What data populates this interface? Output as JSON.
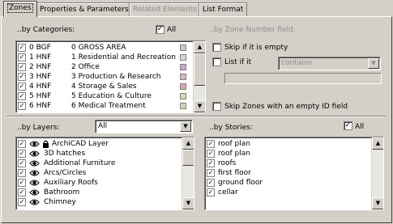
{
  "tabs": [
    {
      "label": "Zones"
    },
    {
      "label": "Properties & Parameters"
    },
    {
      "label": "Related Elements"
    },
    {
      "label": "List Format"
    }
  ],
  "categories": {
    "label": "..by Categories:",
    "all_label": "All",
    "all_checked": true,
    "items": [
      {
        "code": "0 BGF",
        "name": "0 GROSS AREA",
        "checked": true,
        "color": "#c8c8c8"
      },
      {
        "code": "1 HNF",
        "name": "1 Residential and Recreation",
        "checked": true,
        "color": "#e0d0d8"
      },
      {
        "code": "2 HNF",
        "name": "2 Office",
        "checked": true,
        "color": "#c8a8d0"
      },
      {
        "code": "3 HNF",
        "name": "3 Production & Research",
        "checked": true,
        "color": "#d0b8c8"
      },
      {
        "code": "4 HNF",
        "name": "4 Storage & Sales",
        "checked": true,
        "color": "#e0a8a8"
      },
      {
        "code": "5 HNF",
        "name": "5 Education & Culture",
        "checked": true,
        "color": "#d8d8b8"
      },
      {
        "code": "6 HNF",
        "name": "6 Medical Treatment",
        "checked": true,
        "color": "#c8d8b8"
      }
    ]
  },
  "zone_number": {
    "label": "..by Zone Number field:",
    "skip_empty": "Skip if it is empty",
    "list_if": "List if it",
    "condition": "contains",
    "skip_empty_id": "Skip Zones with an empty ID field"
  },
  "layers": {
    "label": "..by Layers:",
    "selected": "All",
    "items": [
      {
        "name": "ArchiCAD Layer",
        "checked": true
      },
      {
        "name": "3D hatches",
        "checked": true
      },
      {
        "name": "Additional Furniture",
        "checked": true
      },
      {
        "name": "Arcs/Circles",
        "checked": true
      },
      {
        "name": "Auxiliary Roofs",
        "checked": true
      },
      {
        "name": "Bathroom",
        "checked": true
      },
      {
        "name": "Chimney",
        "checked": true
      }
    ]
  },
  "stores": {
    "label": "..by Stories:",
    "all_label": "All",
    "all_checked": true,
    "items": [
      {
        "name": "roof plan",
        "checked": true
      },
      {
        "name": "roof plan",
        "checked": true
      },
      {
        "name": "roofs",
        "checked": true
      },
      {
        "name": "first floor",
        "checked": true
      },
      {
        "name": "ground floor",
        "checked": true
      },
      {
        "name": "cellar",
        "checked": true
      }
    ]
  }
}
